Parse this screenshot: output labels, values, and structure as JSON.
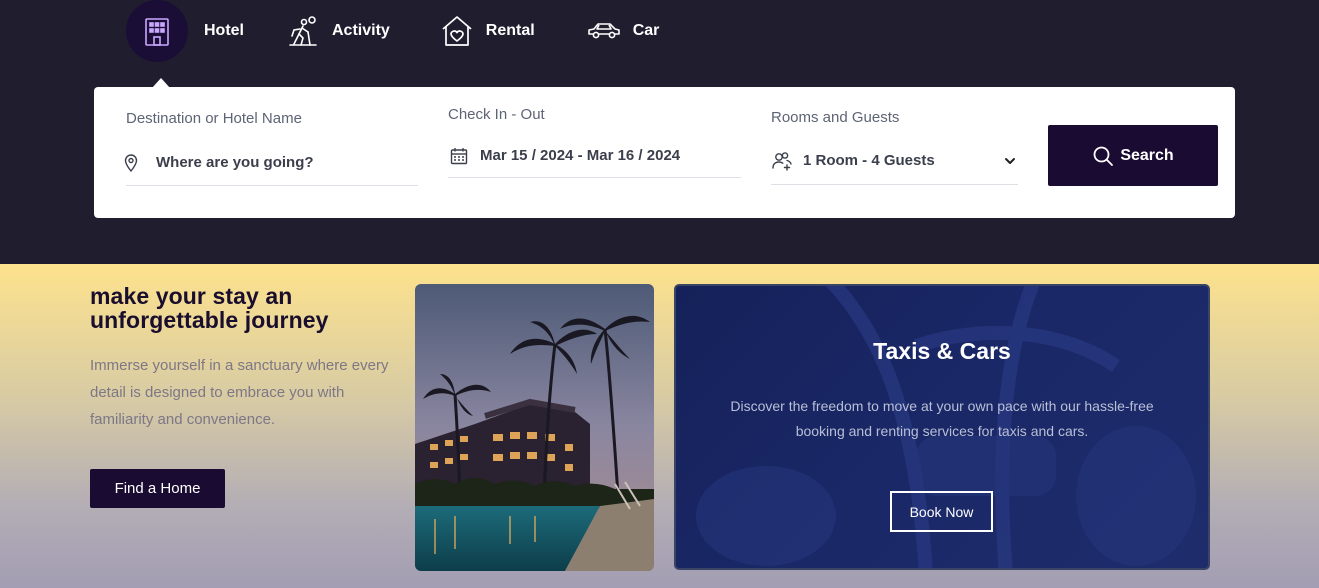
{
  "tabs": [
    {
      "label": "Hotel",
      "icon": "hotel-building-icon",
      "active": true
    },
    {
      "label": "Activity",
      "icon": "hiking-person-icon",
      "active": false
    },
    {
      "label": "Rental",
      "icon": "house-heart-icon",
      "active": false
    },
    {
      "label": "Car",
      "icon": "car-icon",
      "active": false
    }
  ],
  "search": {
    "destination": {
      "label": "Destination or Hotel Name",
      "value": "Where are you going?",
      "icon": "map-pin-icon"
    },
    "dates": {
      "label": "Check In - Out",
      "value": "Mar 15 / 2024 - Mar 16 / 2024",
      "icon": "calendar-icon"
    },
    "rooms": {
      "label": "Rooms and Guests",
      "value": "1 Room - 4 Guests",
      "icon": "users-plus-icon"
    },
    "button_label": "Search"
  },
  "hero": {
    "title": "make your stay an unforgettable journey",
    "text": "Immerse yourself in a sanctuary where every detail is designed to embrace you with familiarity and convenience.",
    "button_label": "Find a Home"
  },
  "taxi": {
    "title": "Taxis & Cars",
    "text": "Discover the freedom to move at your own pace with our hassle-free booking and renting services for taxis and cars.",
    "button_label": "Book Now"
  },
  "colors": {
    "top_band": "#201d2f",
    "accent_dark": "#1a0b33",
    "taxi_card": "#1a2868",
    "gradient_top": "#fde28d",
    "gradient_bottom": "#a39db3"
  }
}
